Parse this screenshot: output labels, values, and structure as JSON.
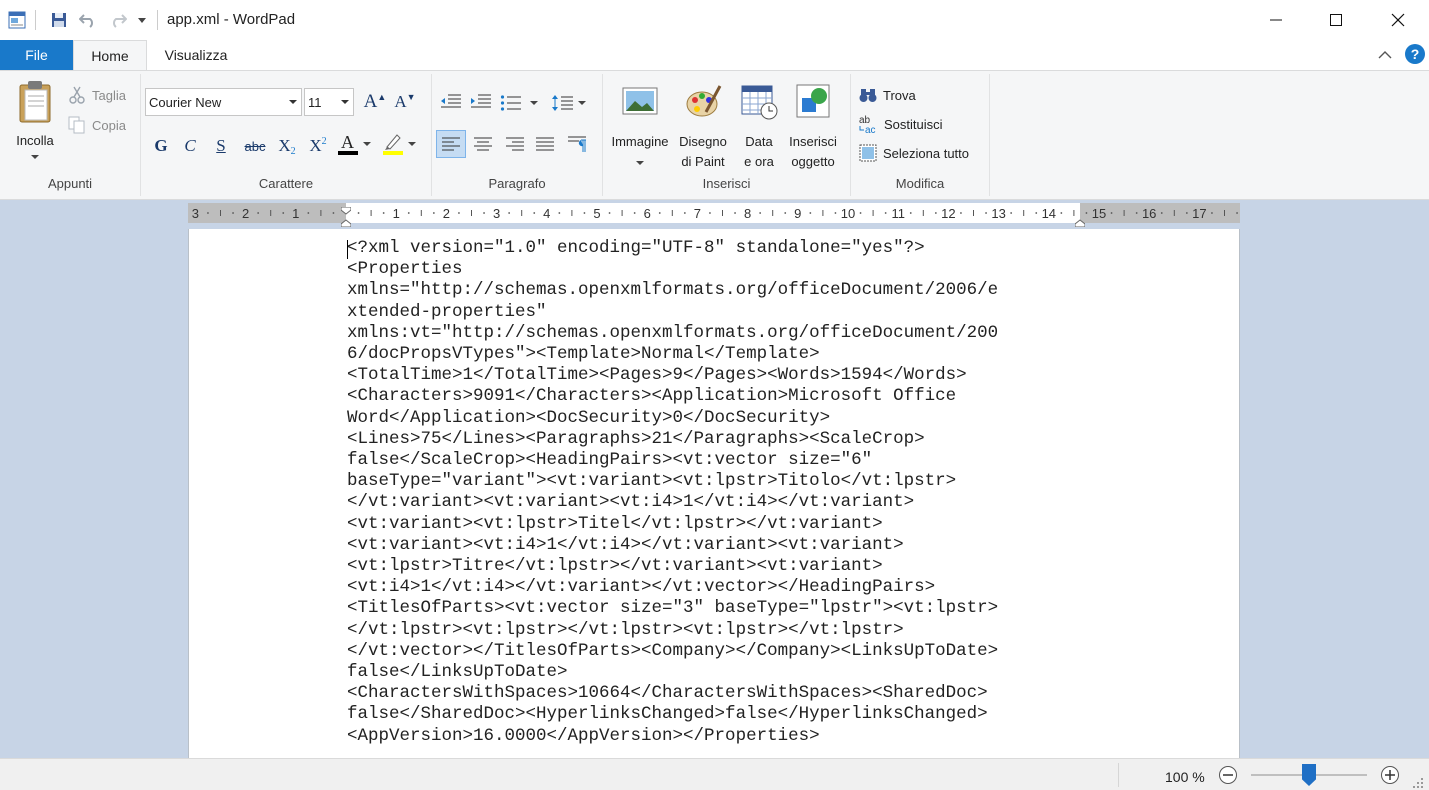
{
  "window": {
    "title": "app.xml - WordPad",
    "minimize_glyph": "—",
    "maximize_glyph": "☐",
    "close_glyph": "✕"
  },
  "tabs": [
    {
      "label": "File"
    },
    {
      "label": "Home"
    },
    {
      "label": "Visualizza"
    }
  ],
  "ribbon": {
    "clipboard": {
      "group_label": "Appunti",
      "paste": "Incolla",
      "cut": "Taglia",
      "copy": "Copia"
    },
    "font": {
      "group_label": "Carattere",
      "family": "Courier New",
      "size": "11",
      "grow_glyph": "A",
      "shrink_glyph": "A",
      "bold": "G",
      "italic": "C",
      "underline": "S",
      "strikethrough": "abc",
      "subscript": "X",
      "superscript": "X",
      "subscript_mark": "2",
      "superscript_mark": "2",
      "text_color_glyph": "A",
      "text_color": "#000000",
      "highlight_color": "#ffff00"
    },
    "paragraph": {
      "group_label": "Paragrafo"
    },
    "insert": {
      "group_label": "Inserisci",
      "picture": "Immagine",
      "paint_line1": "Disegno",
      "paint_line2": "di Paint",
      "datetime_line1": "Data",
      "datetime_line2": "e ora",
      "object_line1": "Inserisci",
      "object_line2": "oggetto"
    },
    "edit": {
      "group_label": "Modifica",
      "find": "Trova",
      "replace": "Sostituisci",
      "select_all": "Seleziona tutto"
    }
  },
  "ruler": {
    "labels": [
      "3",
      "2",
      "1",
      "1",
      "2",
      "3",
      "4",
      "5",
      "6",
      "7",
      "8",
      "9",
      "10",
      "11",
      "12",
      "13",
      "14",
      "15",
      "16",
      "17"
    ]
  },
  "document": {
    "lines": [
      "<?xml version=\"1.0\" encoding=\"UTF-8\" standalone=\"yes\"?>",
      "<Properties",
      "xmlns=\"http://schemas.openxmlformats.org/officeDocument/2006/e",
      "xtended-properties\"",
      "xmlns:vt=\"http://schemas.openxmlformats.org/officeDocument/200",
      "6/docPropsVTypes\"><Template>Normal</Template>",
      "<TotalTime>1</TotalTime><Pages>9</Pages><Words>1594</Words>",
      "<Characters>9091</Characters><Application>Microsoft Office",
      "Word</Application><DocSecurity>0</DocSecurity>",
      "<Lines>75</Lines><Paragraphs>21</Paragraphs><ScaleCrop>",
      "false</ScaleCrop><HeadingPairs><vt:vector size=\"6\"",
      "baseType=\"variant\"><vt:variant><vt:lpstr>Titolo</vt:lpstr>",
      "</vt:variant><vt:variant><vt:i4>1</vt:i4></vt:variant>",
      "<vt:variant><vt:lpstr>Titel</vt:lpstr></vt:variant>",
      "<vt:variant><vt:i4>1</vt:i4></vt:variant><vt:variant>",
      "<vt:lpstr>Titre</vt:lpstr></vt:variant><vt:variant>",
      "<vt:i4>1</vt:i4></vt:variant></vt:vector></HeadingPairs>",
      "<TitlesOfParts><vt:vector size=\"3\" baseType=\"lpstr\"><vt:lpstr>",
      "</vt:lpstr><vt:lpstr></vt:lpstr><vt:lpstr></vt:lpstr>",
      "</vt:vector></TitlesOfParts><Company></Company><LinksUpToDate>",
      "false</LinksUpToDate>",
      "<CharactersWithSpaces>10664</CharactersWithSpaces><SharedDoc>",
      "false</SharedDoc><HyperlinksChanged>false</HyperlinksChanged>",
      "<AppVersion>16.0000</AppVersion></Properties>"
    ]
  },
  "statusbar": {
    "zoom": "100 %",
    "zoom_percent": 100
  },
  "colors": {
    "accent": "#1979ca",
    "canvas_bg": "#c7d4e6"
  }
}
